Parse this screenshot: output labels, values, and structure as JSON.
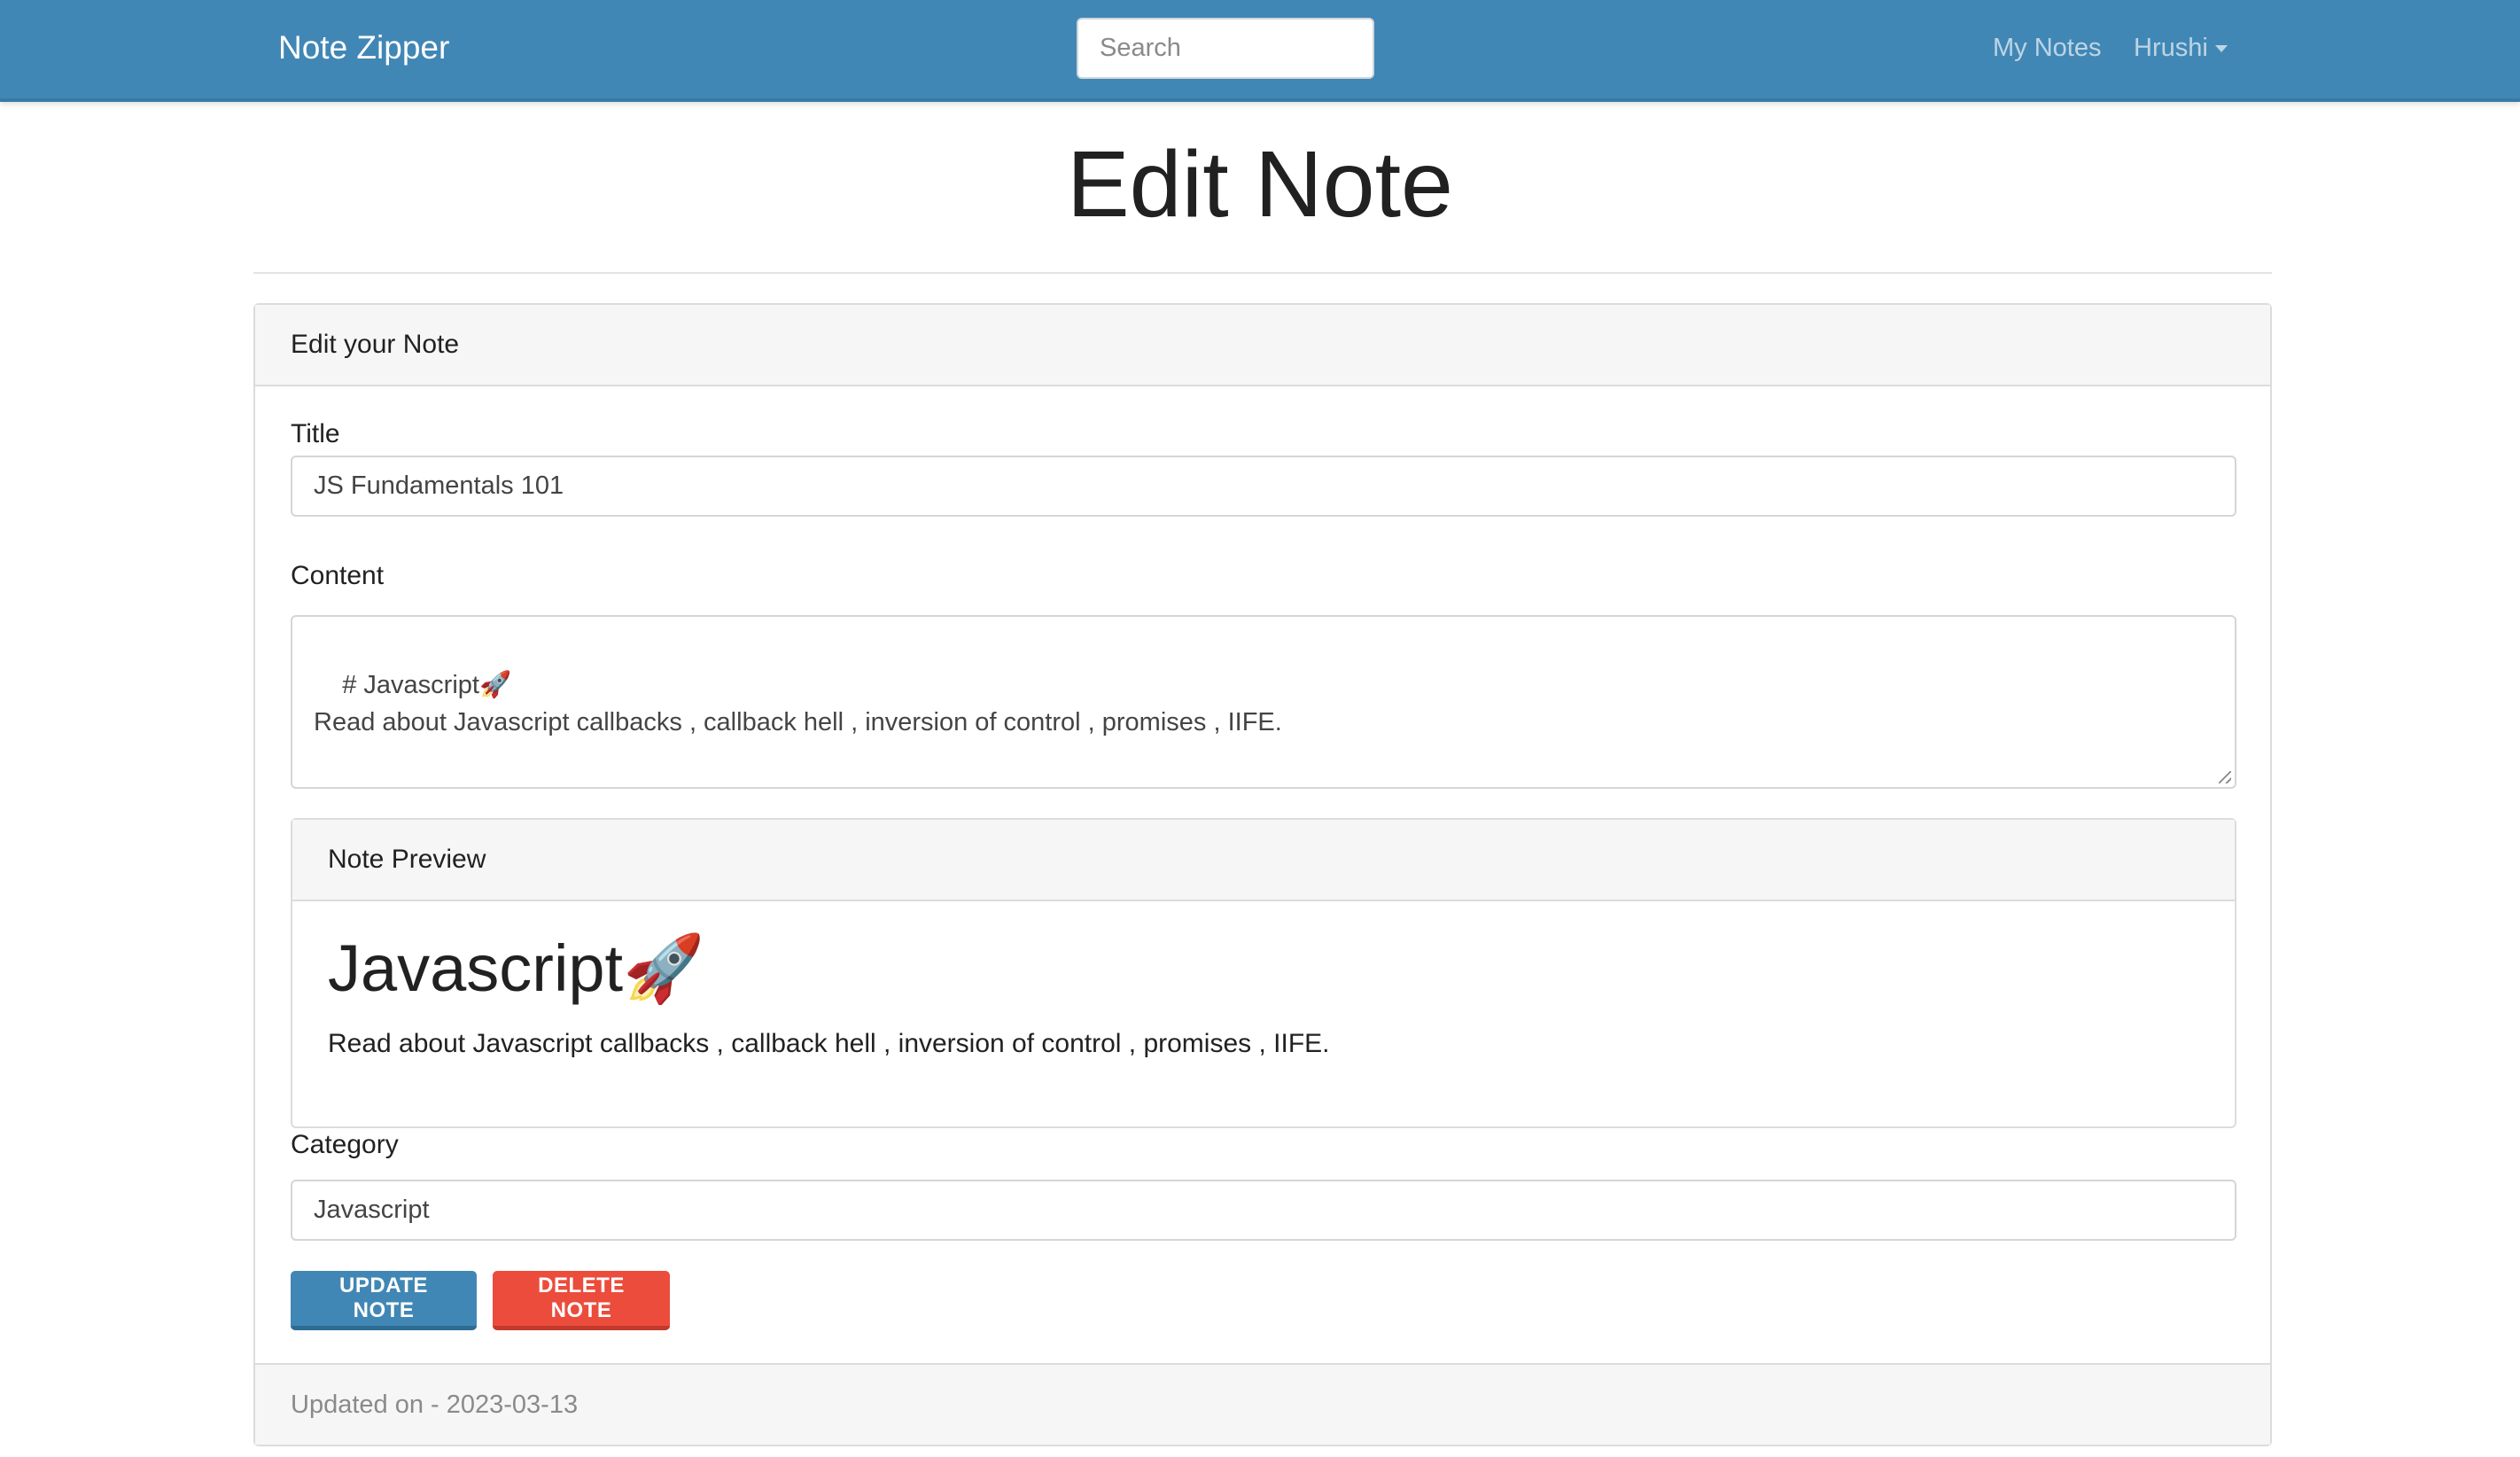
{
  "navbar": {
    "brand": "Note Zipper",
    "search_placeholder": "Search",
    "links": {
      "my_notes": "My Notes",
      "user": "Hrushi"
    },
    "background_color": "#4187b5"
  },
  "page": {
    "title": "Edit Note"
  },
  "card": {
    "header": "Edit your Note",
    "title_label": "Title",
    "title_value": "JS Fundamentals 101",
    "content_label": "Content",
    "content_value": "# Javascript🚀\nRead about Javascript callbacks , callback hell , inversion of control , promises , IIFE.",
    "preview": {
      "header": "Note Preview",
      "heading": "Javascript",
      "heading_emoji": "🚀",
      "body": "Read about Javascript callbacks , callback hell , inversion of control , promises , IIFE."
    },
    "category_label": "Category",
    "category_value": "Javascript",
    "buttons": {
      "update": "Update Note",
      "delete": "Delete Note"
    },
    "footer": "Updated on - 2023-03-13"
  },
  "colors": {
    "primary": "#4187b5",
    "danger": "#ec4c3c"
  },
  "icons": {
    "rocket": "rocket-icon",
    "dropdown": "chevron-down-icon",
    "resize": "resize-grip-icon"
  }
}
